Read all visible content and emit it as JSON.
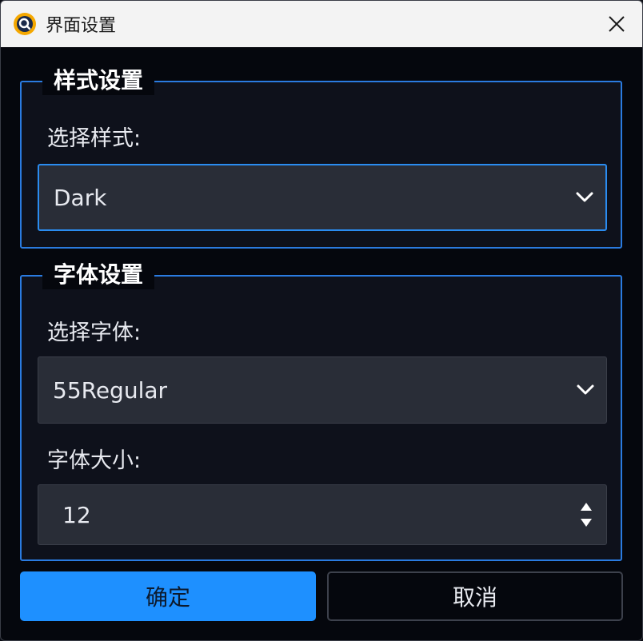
{
  "window": {
    "title": "界面设置"
  },
  "style_group": {
    "title": "样式设置",
    "label": "选择样式:",
    "selected": "Dark"
  },
  "font_group": {
    "title": "字体设置",
    "font_label": "选择字体:",
    "font_selected": "55Regular",
    "size_label": "字体大小:",
    "size_value": "12"
  },
  "buttons": {
    "ok": "确定",
    "cancel": "取消"
  },
  "colors": {
    "accent": "#1e90ff",
    "focus_border": "#2a7be0"
  },
  "icons": {
    "app": "app-logo-icon",
    "close": "close-icon",
    "dropdown": "chevron-down-icon",
    "spin": "spin-arrows-icon"
  }
}
